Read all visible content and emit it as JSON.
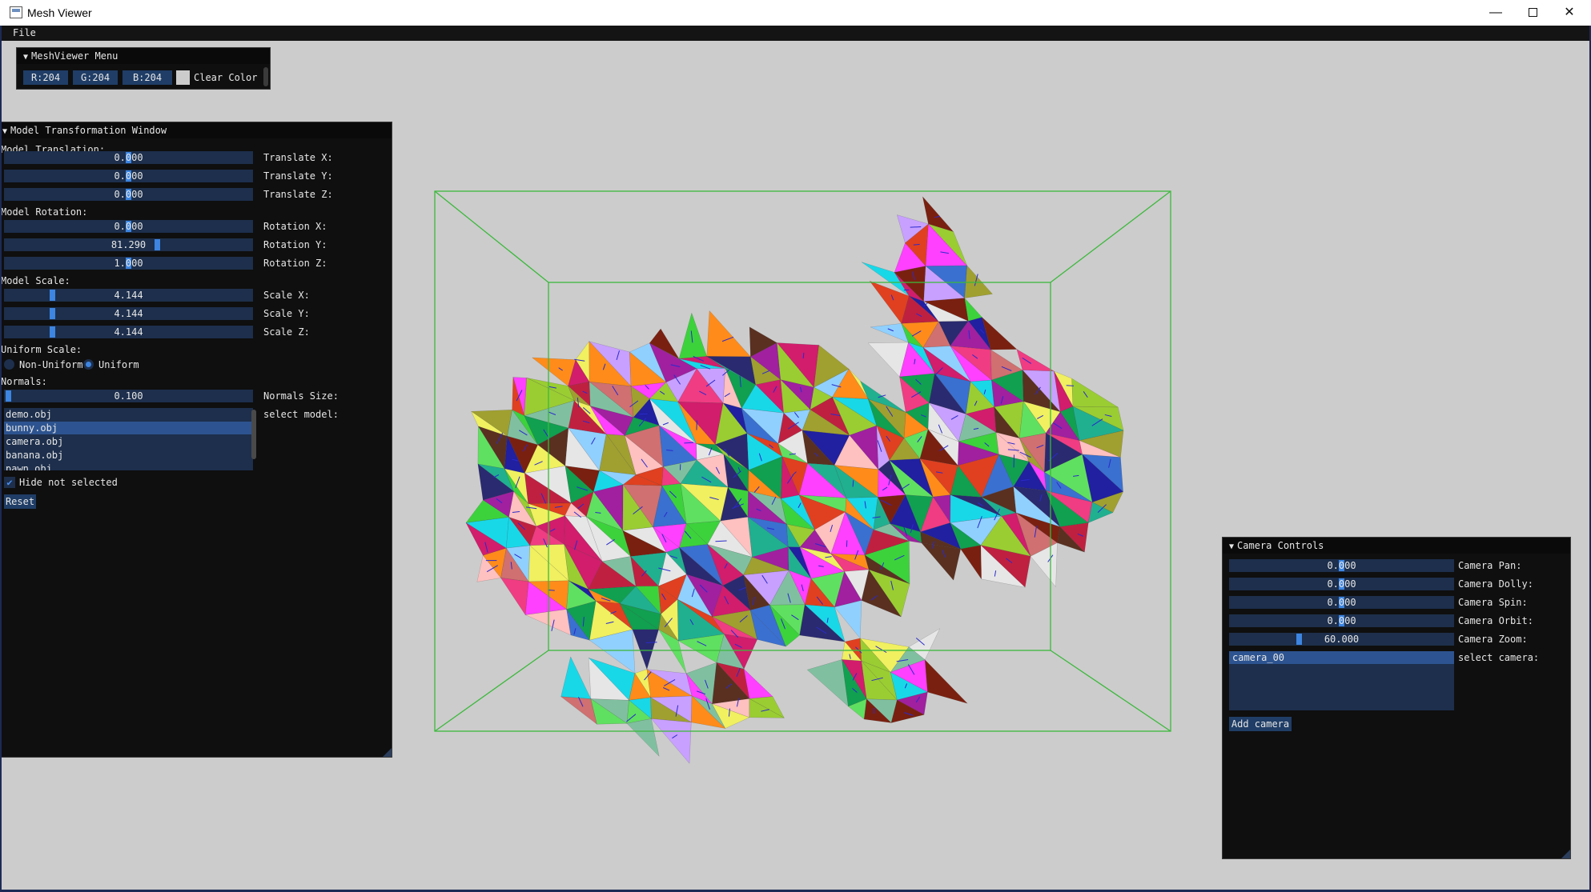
{
  "window": {
    "title": "Mesh Viewer",
    "minimize": "—",
    "close": "✕"
  },
  "menubar": {
    "file": "File"
  },
  "colors": {
    "clear": "#cccccc",
    "accent": "#3d85e0",
    "frame": "#1d2f4c",
    "bbox": "#3cb83c",
    "normals": "#2a2acc"
  },
  "menu_window": {
    "title": "MeshViewer Menu",
    "r": "R:204",
    "g": "G:204",
    "b": "B:204",
    "clear_color": "Clear Color"
  },
  "model_window": {
    "title": "Model Transformation Window",
    "translation_header": "Model Translation:",
    "translate_x": {
      "value": "0.000",
      "label": "Translate X:"
    },
    "translate_y": {
      "value": "0.000",
      "label": "Translate Y:"
    },
    "translate_z": {
      "value": "0.000",
      "label": "Translate Z:"
    },
    "rotation_header": "Model Rotation:",
    "rotation_x": {
      "value": "0.000",
      "label": "Rotation X:"
    },
    "rotation_y": {
      "value": "81.290",
      "label": "Rotation Y:"
    },
    "rotation_z": {
      "value": "1.000",
      "label": "Rotation Z:"
    },
    "scale_header": "Model Scale:",
    "scale_x": {
      "value": "4.144",
      "label": "Scale X:"
    },
    "scale_y": {
      "value": "4.144",
      "label": "Scale Y:"
    },
    "scale_z": {
      "value": "4.144",
      "label": "Scale Z:"
    },
    "uniform_header": "Uniform Scale:",
    "non_uniform": "Non-Uniform",
    "uniform": "Uniform",
    "uniform_selected": true,
    "normals_header": "Normals:",
    "normals_size": {
      "value": "0.100",
      "label": "Normals Size:"
    },
    "select_model_label": "select model:",
    "models": [
      "demo.obj",
      "bunny.obj",
      "camera.obj",
      "banana.obj",
      "pawn.obj"
    ],
    "selected_model": "bunny.obj",
    "hide_not_selected": "Hide not selected",
    "hide_checked": true,
    "reset": "Reset"
  },
  "camera_window": {
    "title": "Camera Controls",
    "pan": {
      "value": "0.000",
      "label": "Camera Pan:"
    },
    "dolly": {
      "value": "0.000",
      "label": "Camera Dolly:"
    },
    "spin": {
      "value": "0.000",
      "label": "Camera Spin:"
    },
    "orbit": {
      "value": "0.000",
      "label": "Camera Orbit:"
    },
    "zoom": {
      "value": "60.000",
      "label": "Camera Zoom:"
    },
    "select_camera_label": "select camera:",
    "cameras": [
      "camera_00"
    ],
    "add_camera": "Add camera"
  },
  "mesh": {
    "model": "bunny"
  }
}
